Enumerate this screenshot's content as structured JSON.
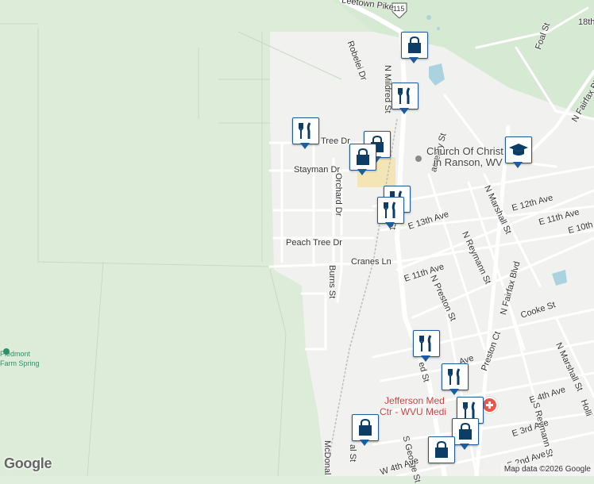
{
  "map": {
    "route_shield": "115",
    "street_labels": {
      "leetown": "Leetown Pike",
      "robelei": "Robelei Dr",
      "foal": "Foal St",
      "n_fairfax": "N Fairfax Blvd",
      "n_mildred": "N Mildred St",
      "tree_dr": "Tree Dr",
      "stayman": "Stayman Dr",
      "orchard": "Orchard Dr",
      "peach_tree": "Peach Tree Dr",
      "cranes": "Cranes Ln",
      "burns": "Burns St",
      "e12th": "E 12th Ave",
      "e11th_right": "E 11th Ave",
      "e10th": "E 10th A",
      "e13th": "E 13th Ave",
      "e11th": "E 11th Ave",
      "n_marshall_top": "N Marshall St",
      "n_reymann": "N Reymann St",
      "n_preston": "N Preston St",
      "n_fairfax2": "N Fairfax Blvd",
      "cooke": "Cooke St",
      "preston_ct": "Preston Ct",
      "n_marshall_bot": "N Marshall St",
      "e4th": "E 4th Ave",
      "e3rd": "E 3rd Ave",
      "e2nd": "E 2nd Ave",
      "s_reymann": "S Reymann St",
      "s_george": "S George St",
      "w4th": "W 4th Ave",
      "mcdonald": "McDonal",
      "eighteenth": "18th",
      "holl": "Holli",
      "mildred_frag": "ed St",
      "mildred_frag2": "d St",
      "ameary": "ameary St",
      "a_ave": "Ave",
      "al_st": "al St"
    },
    "poi": {
      "church_line1": "Church Of Christ",
      "church_line2": "in Ranson, WV",
      "hospital_line1": "Jefferson Med",
      "hospital_line2": "Ctr - WVU Medi",
      "park_line1": "Piedmont",
      "park_line2": "Farm Spring"
    },
    "markers": [
      {
        "type": "shopping",
        "label": "shopping-marker"
      },
      {
        "type": "restaurant",
        "label": "restaurant-marker"
      },
      {
        "type": "restaurant",
        "label": "restaurant-marker"
      },
      {
        "type": "shopping",
        "label": "shopping-marker"
      },
      {
        "type": "shopping",
        "label": "shopping-marker"
      },
      {
        "type": "education",
        "label": "school-marker"
      },
      {
        "type": "restaurant",
        "label": "restaurant-marker"
      },
      {
        "type": "restaurant",
        "label": "restaurant-marker"
      },
      {
        "type": "restaurant",
        "label": "restaurant-marker"
      },
      {
        "type": "restaurant",
        "label": "restaurant-marker"
      },
      {
        "type": "shopping",
        "label": "shopping-marker"
      },
      {
        "type": "shopping",
        "label": "shopping-marker"
      },
      {
        "type": "shopping",
        "label": "shopping-marker"
      }
    ],
    "logo": "Google",
    "attribution": "Map data ©2026 Google"
  }
}
